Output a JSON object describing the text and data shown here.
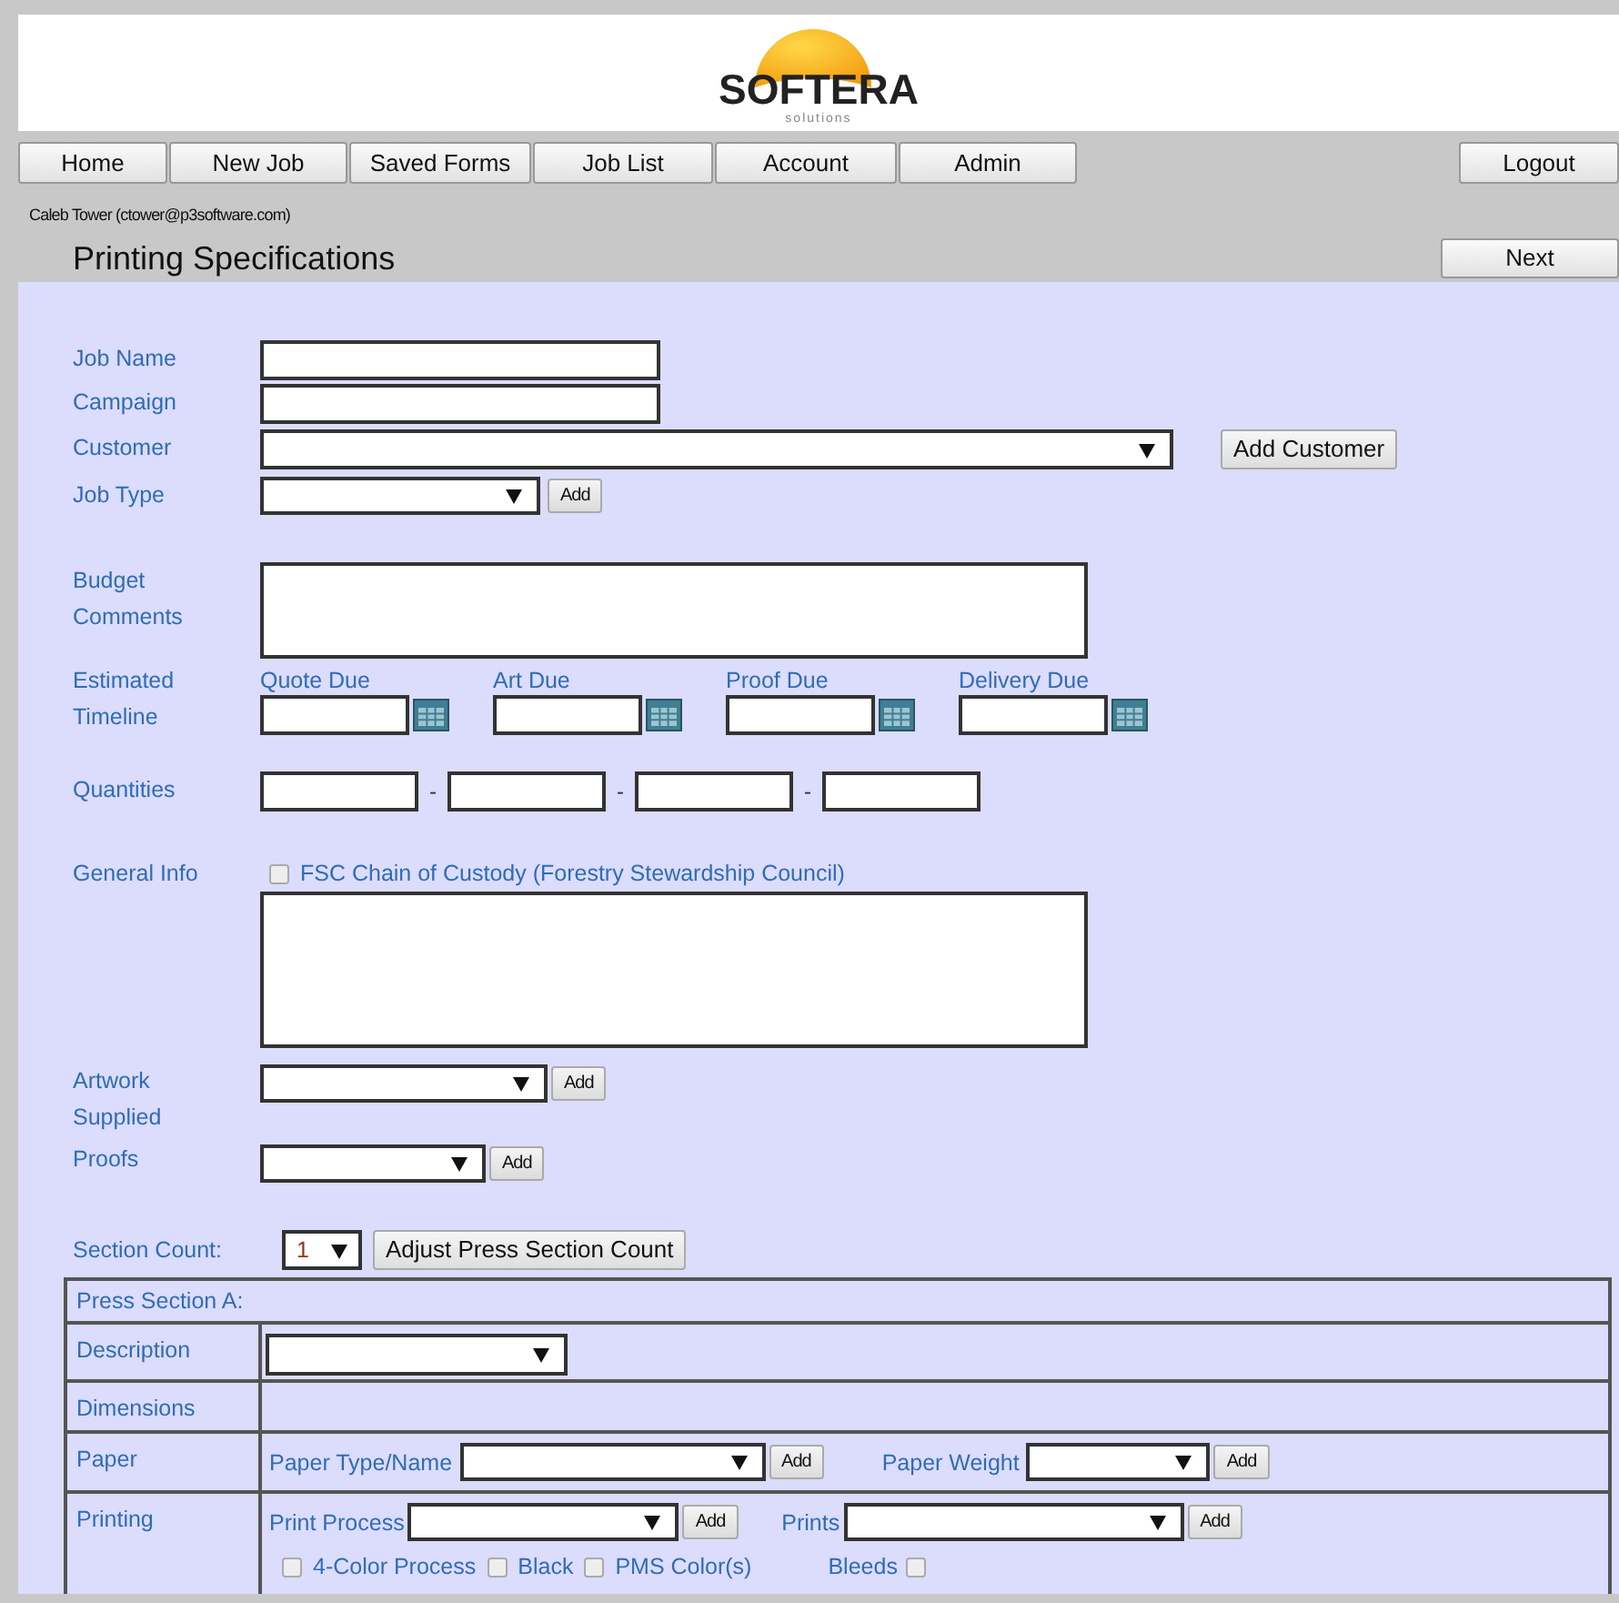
{
  "header": {
    "logo_name": "SOFTERA",
    "logo_tagline": "solutions"
  },
  "nav": {
    "items": [
      {
        "label": "Home"
      },
      {
        "label": "New Job"
      },
      {
        "label": "Saved Forms"
      },
      {
        "label": "Job List"
      },
      {
        "label": "Account"
      },
      {
        "label": "Admin"
      }
    ],
    "logout": "Logout"
  },
  "user": "Caleb Tower (ctower@p3software.com)",
  "title_bar": {
    "title": "Printing Specifications",
    "next": "Next"
  },
  "form": {
    "job_name": {
      "label": "Job Name"
    },
    "campaign": {
      "label": "Campaign"
    },
    "customer": {
      "label": "Customer",
      "button": "Add Customer"
    },
    "job_type": {
      "label": "Job Type",
      "button": "Add"
    },
    "budget_comments": {
      "label": "Budget Comments"
    },
    "timeline": {
      "label": "Estimated Timeline",
      "dates": [
        "Quote Due",
        "Art Due",
        "Proof Due",
        "Delivery Due"
      ]
    },
    "quantities": {
      "label": "Quantities",
      "separators": [
        "-",
        "-",
        "-"
      ]
    },
    "general_info": {
      "label": "General Info",
      "checkbox": {
        "label": "FSC Chain of Custody (Forestry Stewardship Council)",
        "checked": false
      }
    },
    "artwork": {
      "label": "Artwork Supplied",
      "button": "Add"
    },
    "proofs": {
      "label": "Proofs",
      "button": "Add"
    },
    "section_count": {
      "label": "Section Count:",
      "value": "1",
      "button": "Adjust Press Section Count"
    }
  },
  "press_section": {
    "title": "Press Section A:",
    "rows": [
      {
        "kind": "select",
        "label": "Description"
      },
      {
        "kind": "empty",
        "label": "Dimensions"
      },
      {
        "kind": "paper",
        "label": "Paper",
        "type_label": "Paper Type/Name",
        "type_button": "Add",
        "weight_label": "Paper Weight",
        "weight_button": "Add"
      },
      {
        "kind": "printing",
        "label": "Printing",
        "process_label": "Print Process",
        "process_button": "Add",
        "prints_label": "Prints",
        "prints_button": "Add",
        "options": [
          {
            "label": "4-Color Process",
            "checked": false
          },
          {
            "label": "Black",
            "checked": false
          },
          {
            "label": "PMS Color(s)",
            "checked": false
          }
        ],
        "bleeds": {
          "label": "Bleeds",
          "checked": false
        }
      }
    ]
  }
}
